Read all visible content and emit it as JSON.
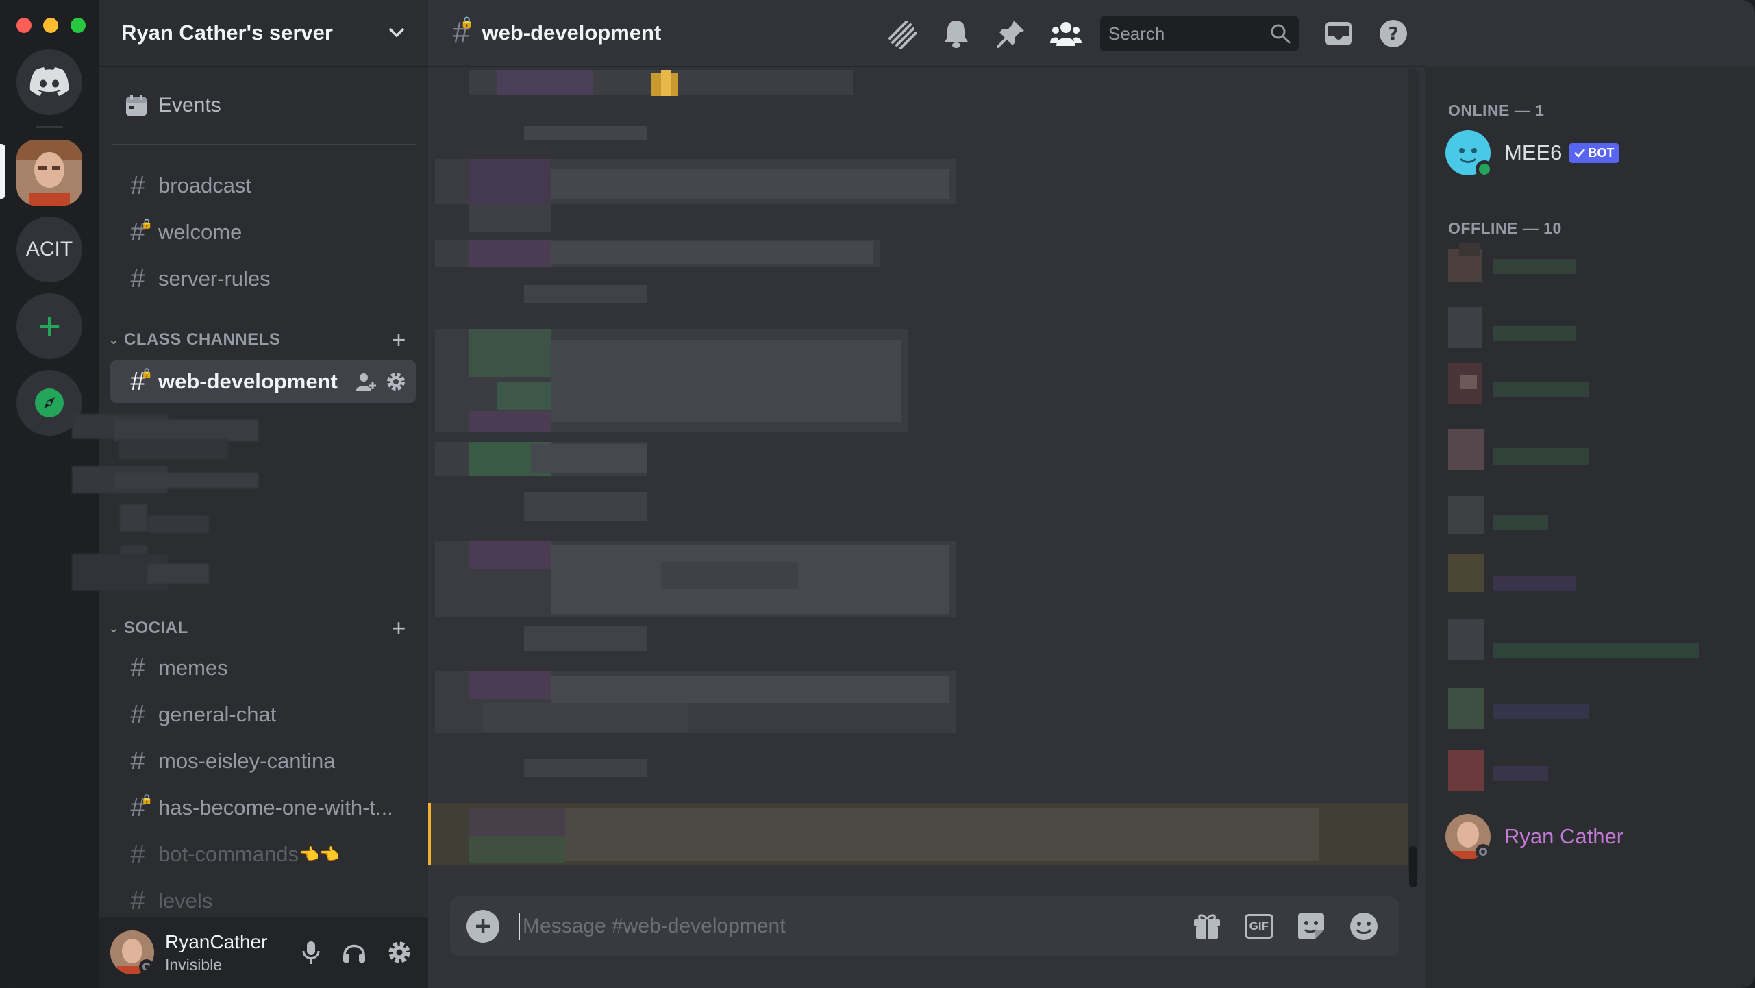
{
  "window": {
    "traffic_lights": [
      "close",
      "minimize",
      "zoom"
    ]
  },
  "server_rail": {
    "home_icon": "discord-logo-icon",
    "servers": [
      {
        "type": "avatar",
        "active": true
      },
      {
        "type": "text",
        "label": "ACIT"
      }
    ],
    "add_icon": "plus-icon",
    "explore_icon": "compass-icon"
  },
  "sidebar": {
    "server_name": "Ryan Cather's server",
    "events_label": "Events",
    "top_channels": [
      {
        "name": "broadcast",
        "locked": false
      },
      {
        "name": "welcome",
        "locked": true
      },
      {
        "name": "server-rules",
        "locked": false
      }
    ],
    "categories": [
      {
        "name": "CLASS CHANNELS",
        "channels": [
          {
            "name": "web-development",
            "locked": true,
            "active": true
          }
        ]
      },
      {
        "name": "SOCIAL",
        "channels": [
          {
            "name": "memes",
            "locked": false
          },
          {
            "name": "general-chat",
            "locked": false
          },
          {
            "name": "mos-eisley-cantina",
            "locked": false
          },
          {
            "name": "has-become-one-with-t...",
            "locked": true
          },
          {
            "name": "bot-commands",
            "locked": false,
            "muted": true,
            "emoji": "👈👈"
          },
          {
            "name": "levels",
            "locked": false,
            "muted": true
          }
        ]
      }
    ],
    "user_panel": {
      "username": "RyanCather",
      "status": "Invisible"
    }
  },
  "chat": {
    "channel_name": "web-development",
    "search_placeholder": "Search",
    "composer_placeholder": "Message #web-development",
    "header_icons": [
      "threads-icon",
      "notification-bell-icon",
      "pin-icon",
      "member-list-icon",
      "inbox-icon",
      "help-icon"
    ],
    "composer_icons": [
      "gift-icon",
      "gif-icon",
      "sticker-icon",
      "emoji-icon"
    ]
  },
  "members": {
    "online_header": "ONLINE — 1",
    "offline_header": "OFFLINE — 10",
    "online": [
      {
        "name": "MEE6",
        "badge": "BOT",
        "color": "#dbdee1"
      }
    ],
    "offline_visible": [
      {
        "name": "Ryan Cather",
        "color": "#c27ad6"
      }
    ]
  },
  "colors": {
    "accent": "#5865f2",
    "online": "#23a55a",
    "add_server": "#23a55a",
    "highlight_bar": "#f0b232"
  }
}
